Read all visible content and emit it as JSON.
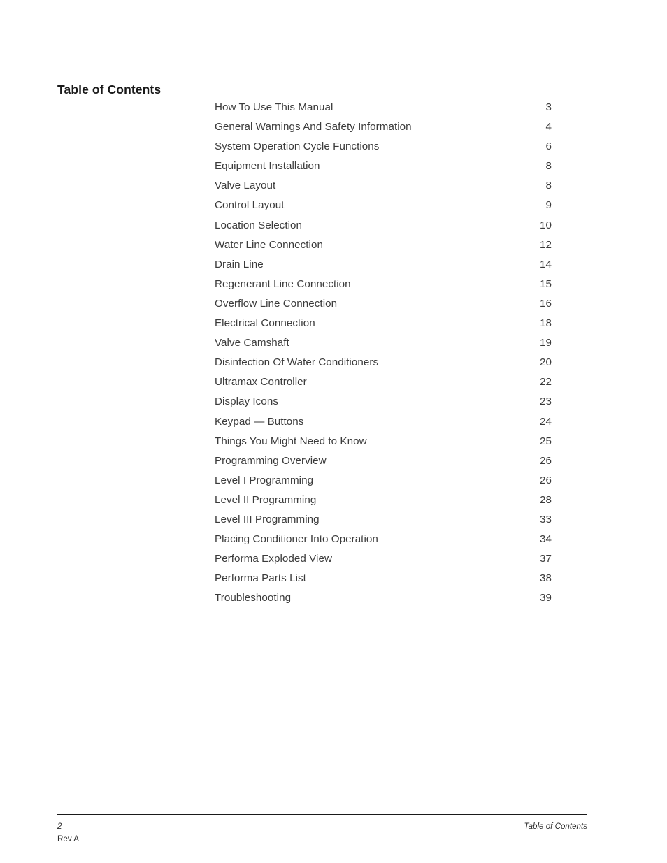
{
  "document": {
    "title": "Table of Contents"
  },
  "toc": {
    "entries": [
      {
        "label": "How To Use This Manual",
        "page": "3"
      },
      {
        "label": "General Warnings And Safety Information",
        "page": "4"
      },
      {
        "label": "System Operation Cycle Functions",
        "page": "6"
      },
      {
        "label": "Equipment Installation",
        "page": "8"
      },
      {
        "label": "Valve Layout",
        "page": "8"
      },
      {
        "label": "Control Layout",
        "page": "9"
      },
      {
        "label": "Location Selection",
        "page": "10"
      },
      {
        "label": "Water Line Connection",
        "page": "12"
      },
      {
        "label": "Drain Line",
        "page": "14"
      },
      {
        "label": "Regenerant Line Connection",
        "page": "15"
      },
      {
        "label": "Overflow Line Connection",
        "page": "16"
      },
      {
        "label": "Electrical Connection",
        "page": "18"
      },
      {
        "label": "Valve Camshaft",
        "page": "19"
      },
      {
        "label": "Disinfection Of Water Conditioners",
        "page": "20"
      },
      {
        "label": "Ultramax Controller",
        "page": "22"
      },
      {
        "label": "Display Icons",
        "page": "23"
      },
      {
        "label": "Keypad — Buttons",
        "page": "24"
      },
      {
        "label": "Things You Might Need to Know",
        "page": "25"
      },
      {
        "label": "Programming Overview",
        "page": "26"
      },
      {
        "label": "Level I Programming",
        "page": "26"
      },
      {
        "label": "Level II Programming",
        "page": "28"
      },
      {
        "label": "Level III Programming",
        "page": "33"
      },
      {
        "label": "Placing Conditioner Into Operation",
        "page": "34"
      },
      {
        "label": "Performa Exploded View",
        "page": "37"
      },
      {
        "label": "Performa Parts List",
        "page": "38"
      },
      {
        "label": "Troubleshooting",
        "page": "39"
      }
    ]
  },
  "footer": {
    "page_number": "2",
    "revision": "Rev A",
    "section": "Table of Contents"
  }
}
